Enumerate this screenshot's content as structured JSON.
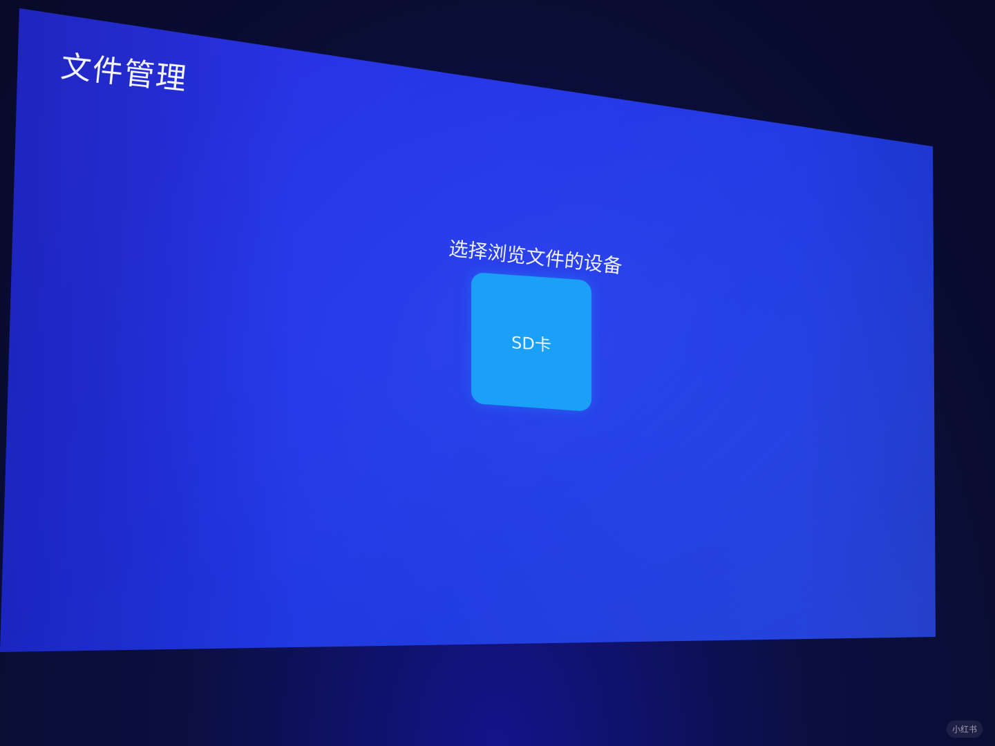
{
  "app": {
    "title": "文件管理"
  },
  "main": {
    "prompt": "选择浏览文件的设备",
    "devices": [
      {
        "label": "SD卡"
      }
    ]
  },
  "watermark": {
    "label": "小红书"
  },
  "colors": {
    "background_blue": "#2434e6",
    "tile_blue": "#1aa0f6",
    "text": "#f2f4ff"
  }
}
